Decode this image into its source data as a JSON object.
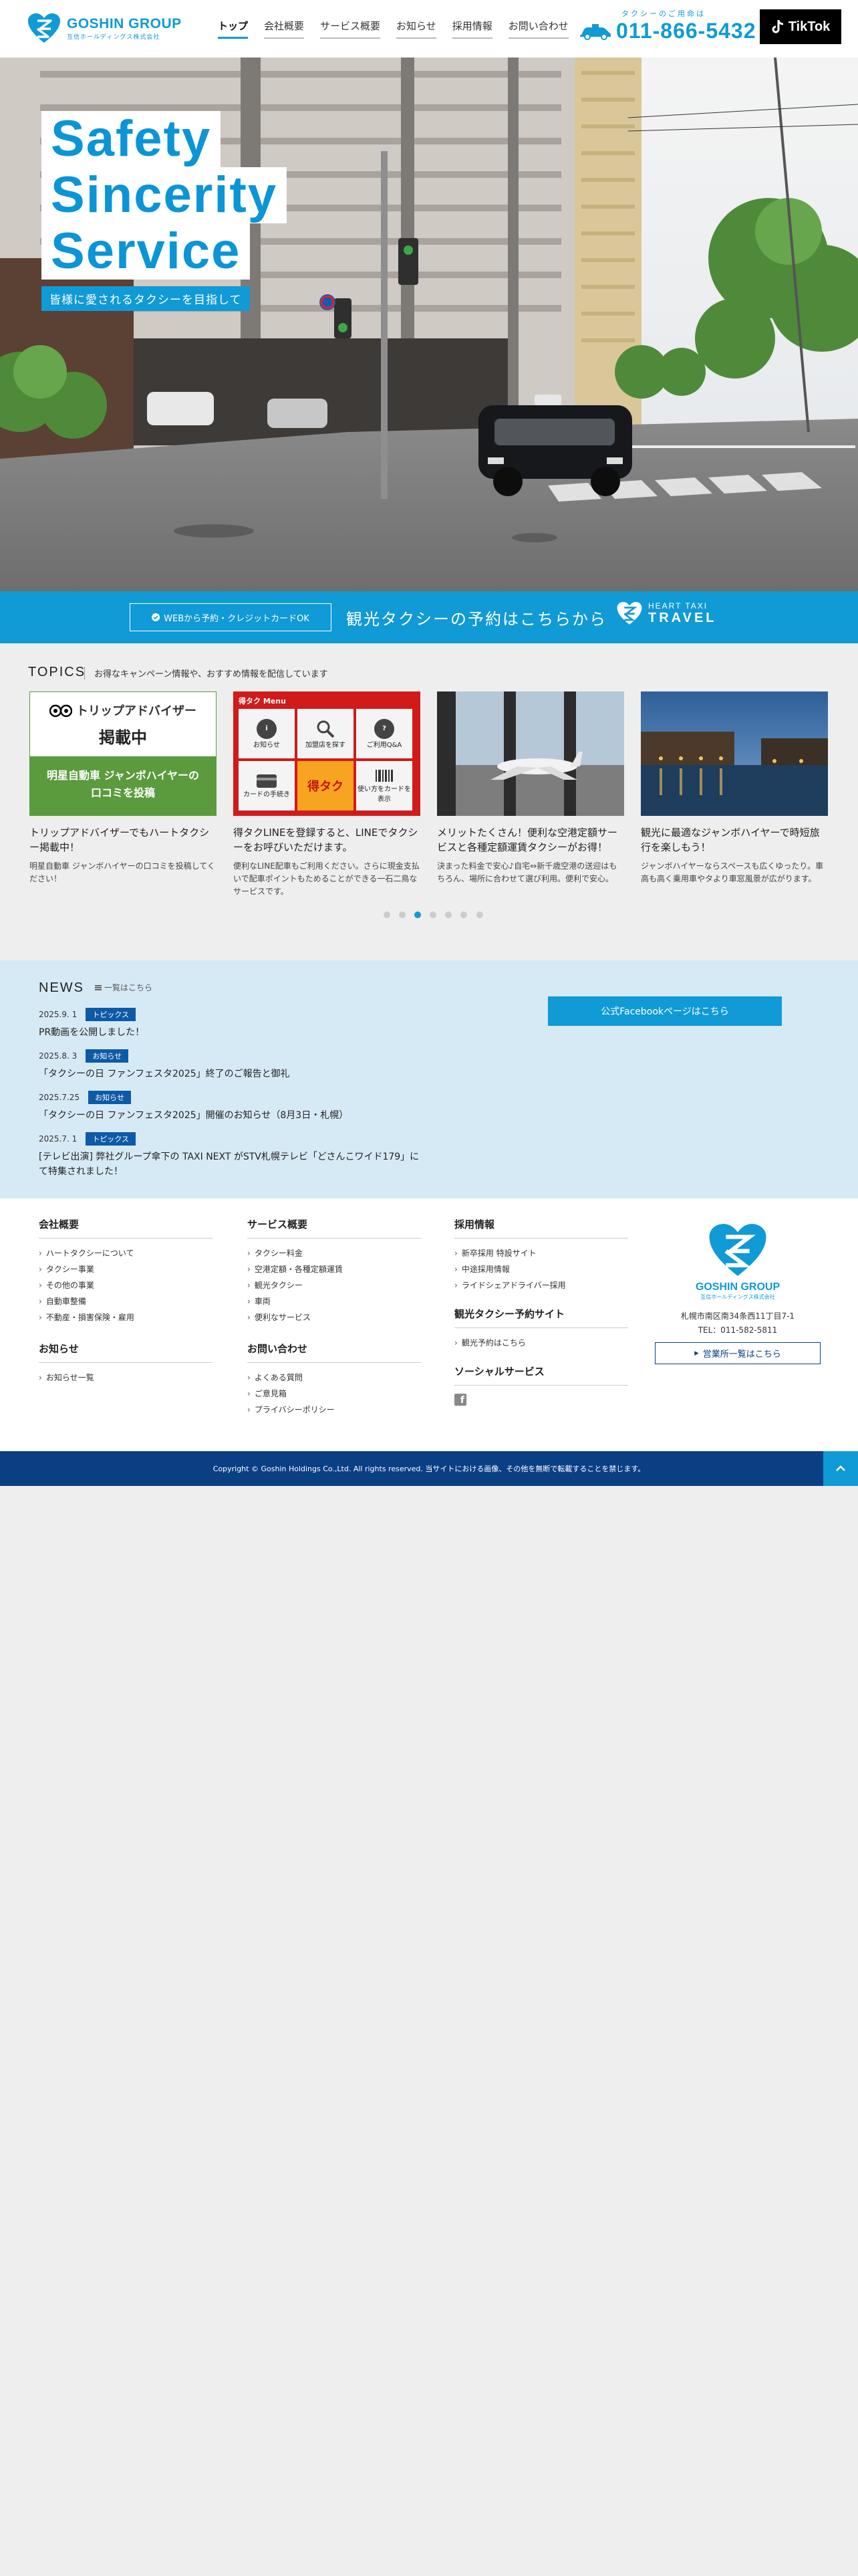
{
  "header": {
    "logo_text": "GOSHIN GROUP",
    "logo_sub": "互信ホールディングス株式会社",
    "nav": [
      {
        "label": "トップ"
      },
      {
        "label": "会社概要"
      },
      {
        "label": "サービス概要"
      },
      {
        "label": "お知らせ"
      },
      {
        "label": "採用情報"
      },
      {
        "label": "お問い合わせ"
      }
    ],
    "phone_caption": "タクシーのご用命は",
    "phone_number": "011-866-5432",
    "tiktok_label": "TikTok"
  },
  "hero": {
    "line1": "Safety",
    "line2": "Sincerity",
    "line3": "Service",
    "tagline": "皆様に愛されるタクシーを目指して"
  },
  "reserve": {
    "button_label": "WEBから予約・クレジットカードOK",
    "text": "観光タクシーの予約はこちらから",
    "brand_top": "HEART TAXI",
    "brand_bottom": "TRAVEL"
  },
  "topics": {
    "title": "TOPICS",
    "description": "お得なキャンペーン情報や、おすすめ情報を配信しています",
    "cards": [
      {
        "img_head": "トリップアドバイザー",
        "img_badge": "掲載中",
        "img_caption": "明星自動車 ジャンボハイヤーの口コミを投稿",
        "title": "トリップアドバイザーでもハートタクシー掲載中！",
        "text": "明星自動車 ジャンボハイヤーの口コミを投稿してください！"
      },
      {
        "img_menu": "得タク Menu",
        "img_items": [
          "お知らせ",
          "加盟店を探す",
          "ご利用Q&A",
          "カードの手続き",
          "得タク",
          "使い方をカードを表示"
        ],
        "title": "得タクLINEを登録すると、LINEでタクシーをお呼びいただけます。",
        "text": "便利なLINE配車もご利用ください。さらに現金支払いで配車ポイントもためることができる一石二鳥なサービスです。"
      },
      {
        "title": "メリットたくさん！便利な空港定額サービスと各種定額運賃タクシーがお得！",
        "text": "決まった料金で安心♪自宅⇔新千歳空港の送迎はもちろん、場所に合わせて選び利用。便利で安心。"
      },
      {
        "title": "観光に最適なジャンボハイヤーで時短旅行を楽しもう！",
        "text": "ジャンボハイヤーならスペースも広くゆったり。車高も高く乗用車やタより車窓風景が広がります。"
      }
    ]
  },
  "news": {
    "title": "NEWS",
    "all_link": "一覧はこちら",
    "items": [
      {
        "date": "2025.9. 1",
        "badge": "トピックス",
        "text": "PR動画を公開しました！"
      },
      {
        "date": "2025.8. 3",
        "badge": "お知らせ",
        "text": "「タクシーの日 ファンフェスタ2025」終了のご報告と御礼"
      },
      {
        "date": "2025.7.25",
        "badge": "お知らせ",
        "text": "「タクシーの日 ファンフェスタ2025」開催のお知らせ（8月3日・札幌）"
      },
      {
        "date": "2025.7. 1",
        "badge": "トピックス",
        "text": "[テレビ出演] 弊社グループ傘下の TAXI NEXT がSTV札幌テレビ「どさんこワイド179」にて特集されました！"
      }
    ],
    "facebook_label": "公式Facebookページはこちら"
  },
  "footer": {
    "col1": {
      "head": "会社概要",
      "items": [
        "ハートタクシーについて",
        "タクシー事業",
        "その他の事業",
        "自動車整備",
        "不動産・損害保険・雇用"
      ],
      "head2": "お知らせ",
      "items2": [
        "お知らせ一覧"
      ]
    },
    "col2": {
      "head": "サービス概要",
      "items": [
        "タクシー料金",
        "空港定額・各種定額運賃",
        "観光タクシー",
        "車両",
        "便利なサービス"
      ],
      "head2": "お問い合わせ",
      "items2": [
        "よくある質問",
        "ご意見箱",
        "プライバシーポリシー"
      ]
    },
    "col3": {
      "head": "採用情報",
      "items": [
        "新卒採用 特設サイト",
        "中途採用情報",
        "ライドシェアドライバー採用"
      ],
      "head2": "観光タクシー予約サイト",
      "items2": [
        "観光予約はこちら"
      ],
      "head3": "ソーシャルサービス"
    },
    "company": {
      "logo_text": "GOSHIN GROUP",
      "logo_sub": "互信ホールディングス株式会社",
      "address": "札幌市南区南34条西11丁目7-1",
      "tel": "TEL：011-582-5811",
      "offices_label": "営業所一覧はこちら"
    },
    "copyright": "Copyright © Goshin Holdings Co.,Ltd. All rights reserved. 当サイトにおける画像、その他を無断で転載することを禁じます。"
  },
  "colors": {
    "brand_blue": "#109ad6",
    "navy": "#0b3f84",
    "news_bg": "#d6eaf6"
  }
}
